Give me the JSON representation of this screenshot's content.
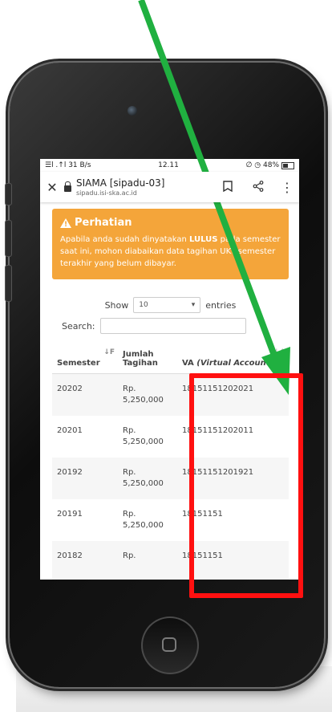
{
  "status_bar": {
    "left": "☰l .↑l 31 B/s",
    "time": "12.11",
    "right": "∅ ◷ 48%"
  },
  "browser": {
    "close_icon": "close-icon",
    "title": "SIAMA [sipadu-03]",
    "url": "sipadu.isi-ska.ac.id",
    "bookmark_icon": "bookmark-icon",
    "share_icon": "share-icon",
    "menu_icon": "more-vert-icon"
  },
  "alert": {
    "title": "Perhatian",
    "text_before": "Apabila anda sudah dinyatakan ",
    "text_bold": "LULUS",
    "text_after": " pada semester saat ini, mohon diabaikan data tagihan UKT semester terakhir yang belum dibayar."
  },
  "datatable": {
    "show_label": "Show",
    "page_size": "10",
    "entries_label": "entries",
    "search_label": "Search:",
    "columns": [
      {
        "label": "Semester"
      },
      {
        "label": "Jumlah Tagihan"
      },
      {
        "label_main": "VA",
        "label_italic": "(Virtual Account)"
      }
    ],
    "rows": [
      {
        "semester": "20202",
        "jumlah_1": "Rp.",
        "jumlah_2": "5,250,000",
        "va": "18151151202021"
      },
      {
        "semester": "20201",
        "jumlah_1": "Rp.",
        "jumlah_2": "5,250,000",
        "va": "18151151202011"
      },
      {
        "semester": "20192",
        "jumlah_1": "Rp.",
        "jumlah_2": "5,250,000",
        "va": "18151151201921"
      },
      {
        "semester": "20191",
        "jumlah_1": "Rp.",
        "jumlah_2": "5,250,000",
        "va": "18151151"
      },
      {
        "semester": "20182",
        "jumlah_1": "Rp.",
        "jumlah_2": "",
        "va": "18151151"
      }
    ]
  },
  "annotation": {
    "arrow_color": "#20b040",
    "box_color": "#ff1010"
  }
}
